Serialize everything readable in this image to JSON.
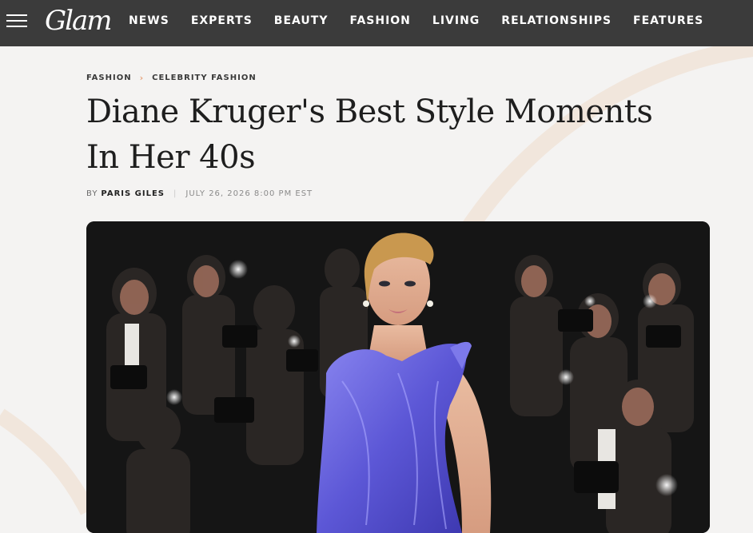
{
  "site": {
    "logo_text": "Glam",
    "menu_icon": "hamburger-icon"
  },
  "nav": {
    "items": [
      "NEWS",
      "EXPERTS",
      "BEAUTY",
      "FASHION",
      "LIVING",
      "RELATIONSHIPS",
      "FEATURES"
    ]
  },
  "breadcrumb": {
    "items": [
      "FASHION",
      "CELEBRITY FASHION"
    ],
    "separator_icon": "chevron-right-icon"
  },
  "article": {
    "title": "Diane Kruger's Best Style Moments In Her 40s",
    "byline_prefix": "BY",
    "author": "PARIS GILES",
    "date": "JULY 26, 2026 8:00 PM EST"
  },
  "colors": {
    "nav_background": "#3b3b3b",
    "page_background": "#f4f3f2",
    "accent": "#e7a27b",
    "title": "#1e1e1e",
    "gown": "#6b66dd"
  }
}
